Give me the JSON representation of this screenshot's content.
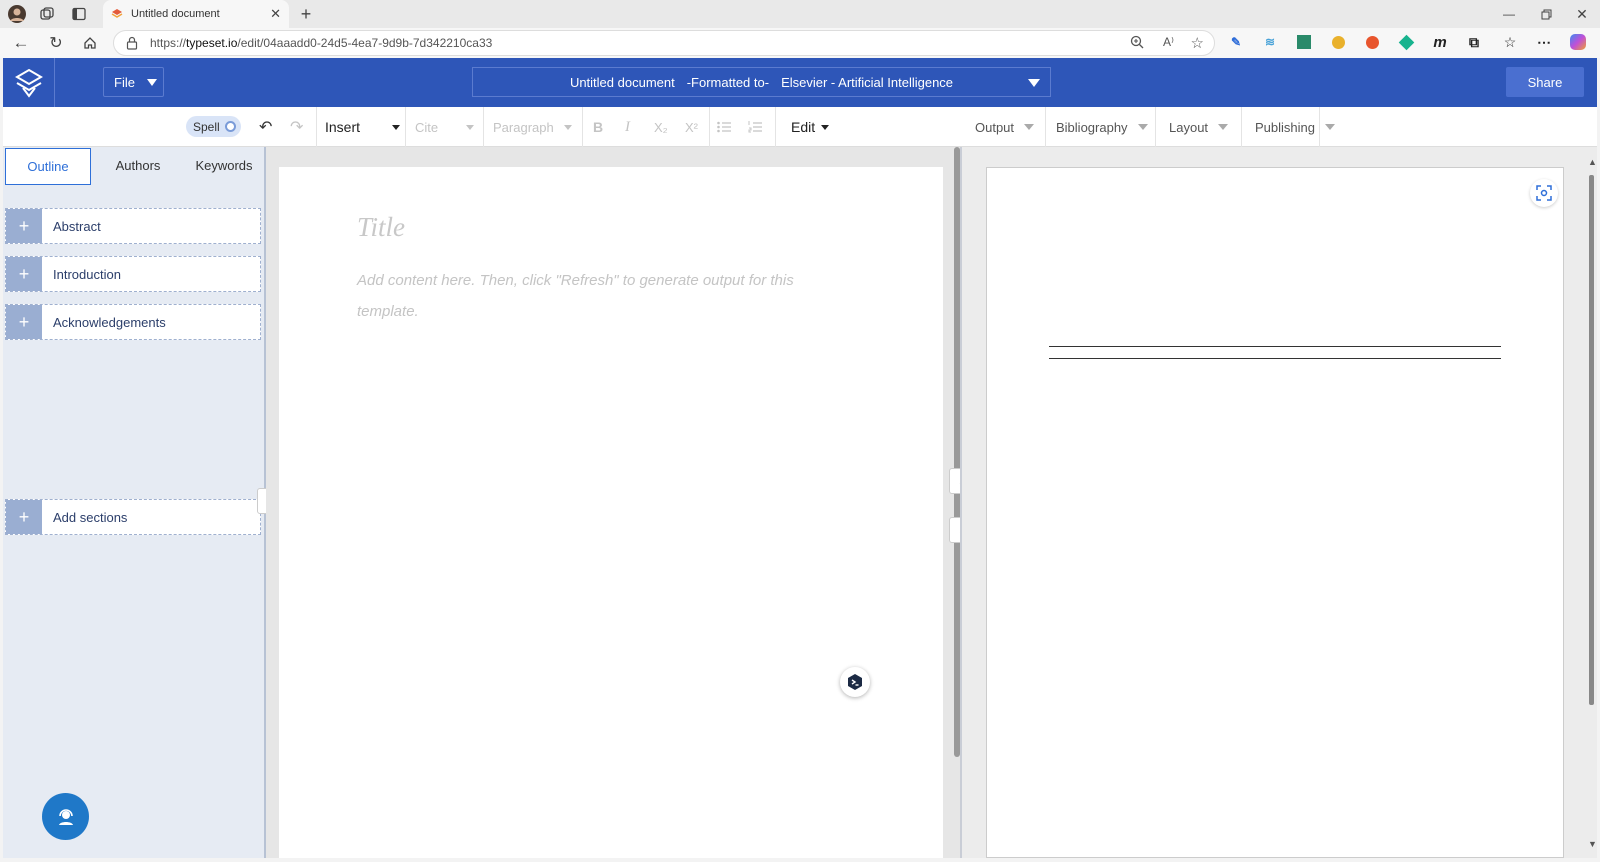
{
  "browser": {
    "tab_title": "Untitled document",
    "url_prefix": "https://",
    "url_host": "typeset.io",
    "url_path": "/edit/04aaadd0-24d5-4ea7-9d9b-7d342210ca33"
  },
  "header": {
    "file_label": "File",
    "doc_name": "Untitled document",
    "formatted_to": "-Formatted to-",
    "template": "Elsevier - Artificial Intelligence",
    "share_label": "Share"
  },
  "toolbar": {
    "spell_label": "Spell",
    "insert_label": "Insert",
    "cite_label": "Cite",
    "paragraph_label": "Paragraph",
    "bold": "B",
    "italic": "I",
    "subscript": "X₂",
    "superscript": "X²",
    "edit_label": "Edit"
  },
  "right_toolbar": {
    "output": "Output",
    "bibliography": "Bibliography",
    "layout": "Layout",
    "publishing": "Publishing"
  },
  "sidebar": {
    "tabs": [
      {
        "label": "Outline"
      },
      {
        "label": "Authors"
      },
      {
        "label": "Keywords"
      }
    ],
    "sections": [
      {
        "label": "Abstract"
      },
      {
        "label": "Introduction"
      },
      {
        "label": "Acknowledgements"
      }
    ],
    "add_sections": "Add sections"
  },
  "editor": {
    "title_placeholder": "Title",
    "content_placeholder": "Add content here. Then, click \"Refresh\" to generate output for this template."
  },
  "colors": {
    "brand": "#2e56b8",
    "accent": "#2e6fd8",
    "sidebar_bg": "#e6ebf3"
  }
}
